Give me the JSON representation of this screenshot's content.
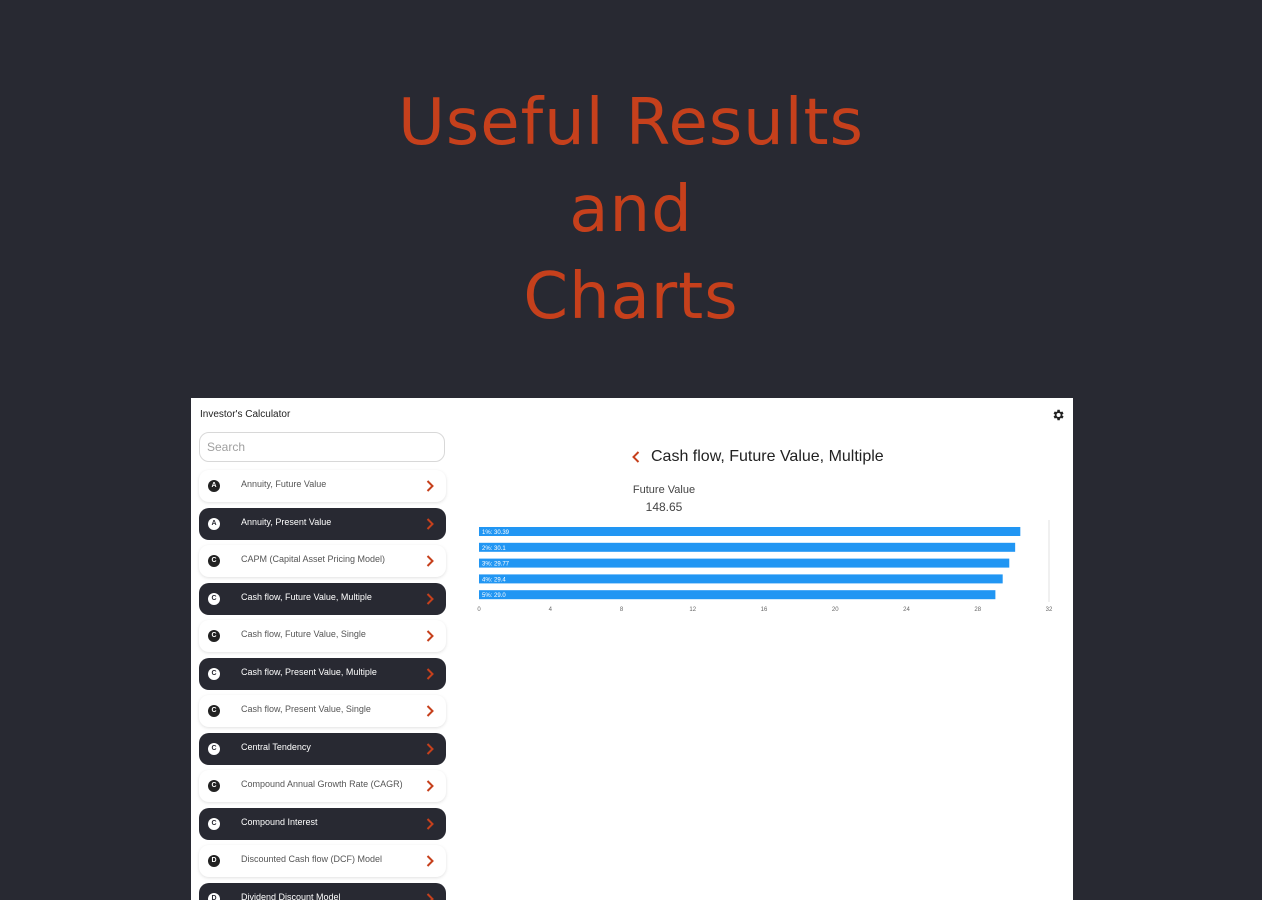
{
  "hero": {
    "line1": "Useful Results",
    "line2": "and",
    "line3": "Charts",
    "color": "#c6401c"
  },
  "app": {
    "title": "Investor's Calculator",
    "settings_icon": "gear-icon",
    "search": {
      "placeholder": "Search",
      "value": ""
    },
    "items": [
      {
        "badge": "A",
        "label": "Annuity, Future Value",
        "dark": false
      },
      {
        "badge": "A",
        "label": "Annuity, Present Value",
        "dark": true
      },
      {
        "badge": "C",
        "label": "CAPM (Capital Asset Pricing Model)",
        "dark": false
      },
      {
        "badge": "C",
        "label": "Cash flow, Future Value, Multiple",
        "dark": true
      },
      {
        "badge": "C",
        "label": "Cash flow, Future Value, Single",
        "dark": false
      },
      {
        "badge": "C",
        "label": "Cash flow, Present Value, Multiple",
        "dark": true
      },
      {
        "badge": "C",
        "label": "Cash flow, Present Value, Single",
        "dark": false
      },
      {
        "badge": "C",
        "label": "Central Tendency",
        "dark": true
      },
      {
        "badge": "C",
        "label": "Compound Annual Growth Rate (CAGR)",
        "dark": false
      },
      {
        "badge": "C",
        "label": "Compound Interest",
        "dark": true
      },
      {
        "badge": "D",
        "label": "Discounted Cash flow (DCF) Model",
        "dark": false
      },
      {
        "badge": "D",
        "label": "Dividend Discount Model",
        "dark": true
      }
    ],
    "accent": "#c6401c",
    "dark_bg": "#282932"
  },
  "panel": {
    "title": "Cash flow, Future Value, Multiple",
    "back_icon": "chevron-left-icon",
    "result_label": "Future Value",
    "result_value": "148.65"
  },
  "chart_data": {
    "type": "bar",
    "orientation": "horizontal",
    "categories": [
      "1",
      "2",
      "3",
      "4",
      "5"
    ],
    "values": [
      30.39,
      30.1,
      29.77,
      29.4,
      28.99
    ],
    "labels": [
      "1%: 30.39",
      "2%: 30.1",
      "3%: 29.77",
      "4%: 29.4",
      "5%: 29.0"
    ],
    "xticks": [
      0,
      4,
      8,
      12,
      16,
      20,
      24,
      28,
      32
    ],
    "xlim": [
      0,
      32
    ],
    "bar_color": "#2196f3",
    "grid": false
  }
}
